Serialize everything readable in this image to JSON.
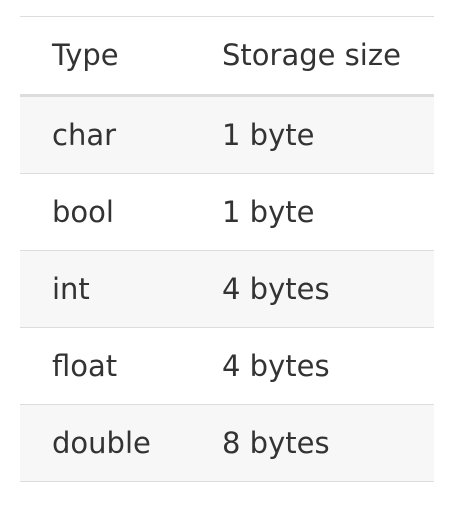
{
  "table": {
    "headers": {
      "type": "Type",
      "storage": "Storage size"
    },
    "rows": [
      {
        "type": "char",
        "size": "1 byte"
      },
      {
        "type": "bool",
        "size": "1 byte"
      },
      {
        "type": "int",
        "size": "4 bytes"
      },
      {
        "type": "float",
        "size": "4 bytes"
      },
      {
        "type": "double",
        "size": "8 bytes"
      }
    ]
  }
}
